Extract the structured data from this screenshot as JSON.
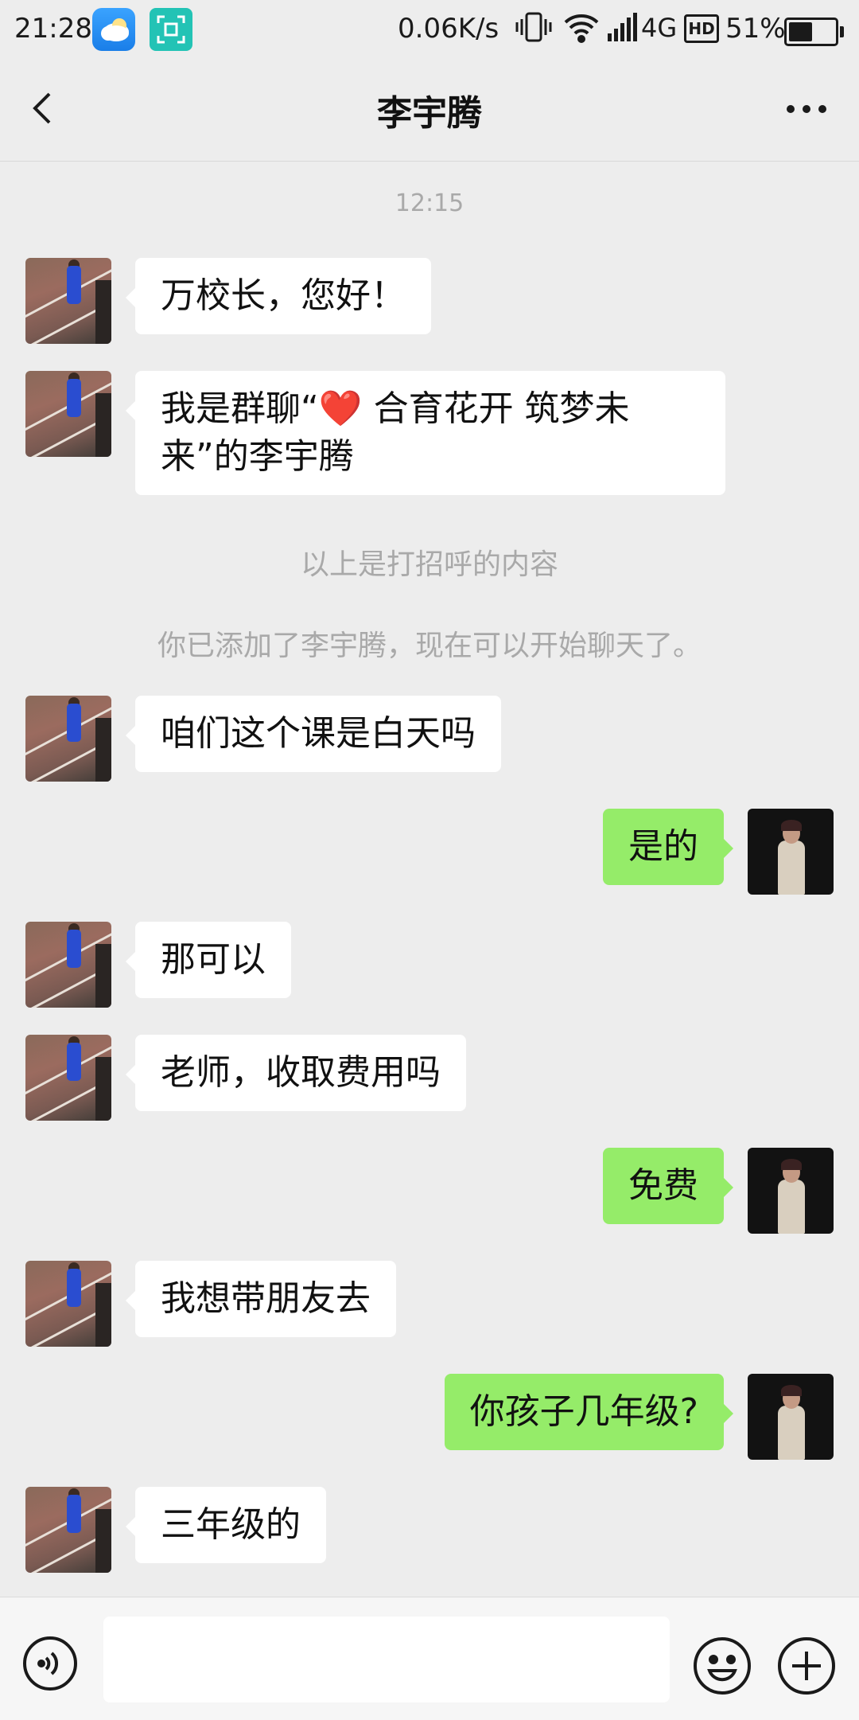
{
  "status_bar": {
    "time": "21:28",
    "net_speed": "0.06K/s",
    "network": "4G",
    "hd": "HD",
    "battery": "51%",
    "battery_level": 0.51
  },
  "header": {
    "title": "李宇腾"
  },
  "messages": {
    "timestamp": "12:15",
    "m1": "万校长，您好！",
    "m2_line1": "我是群聊“❤️  合育花开 筑梦未",
    "m2_line2": "来”的李宇腾",
    "sys1": "以上是打招呼的内容",
    "sys2": "你已添加了李宇腾，现在可以开始聊天了。",
    "m3": "咱们这个课是白天吗",
    "m4": "是的",
    "m5": "那可以",
    "m6": "老师，收取费用吗",
    "m7": "免费",
    "m8": "我想带朋友去",
    "m9": "你孩子几年级?",
    "m10": "三年级的"
  },
  "input": {
    "value": ""
  },
  "colors": {
    "background": "#EDEDED",
    "outgoing_bubble": "#95EC69",
    "incoming_bubble": "#FFFFFF",
    "system_text": "#A9A9A9"
  }
}
